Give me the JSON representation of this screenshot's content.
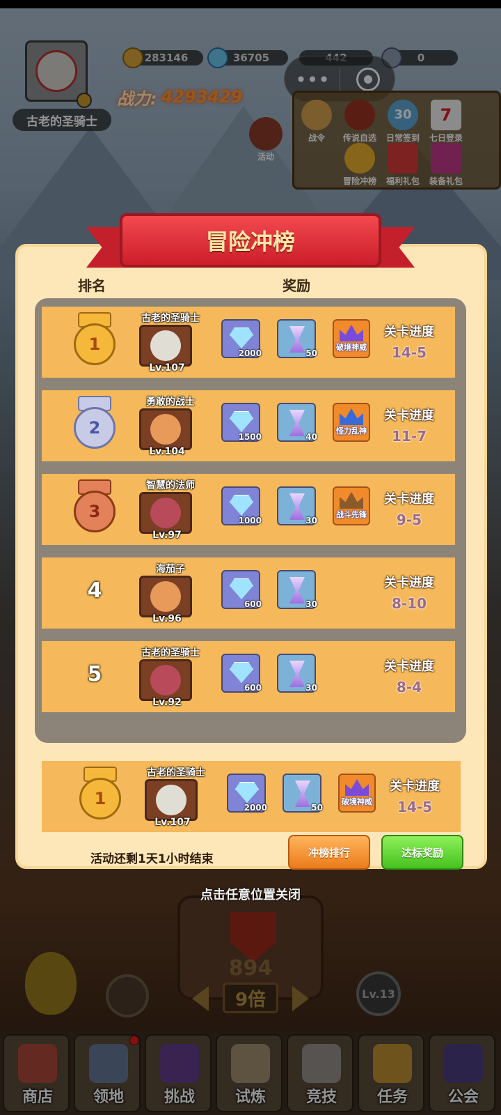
{
  "hud": {
    "player_name": "古老的圣骑士",
    "gold": "283146",
    "diamonds": "36705",
    "resource3": "442",
    "resource4": "0",
    "power_label": "战力:",
    "power_value": "4293429"
  },
  "activities": {
    "left_label": "活动",
    "row1": [
      "战令",
      "传说自选",
      "日常签到",
      "七日登录"
    ],
    "row2": [
      "冒险冲榜",
      "福利礼包",
      "装备礼包"
    ],
    "checkin_badge": "30",
    "seven_day_badge": "7"
  },
  "modal": {
    "title": "冒险冲榜",
    "col_rank": "排名",
    "col_reward": "奖励",
    "progress_label": "关卡进度",
    "rows": [
      {
        "rank": "1",
        "name": "古老的圣骑士",
        "level": "Lv.107",
        "gems": "2000",
        "glass": "50",
        "title": "破境神威",
        "progress": "14-5"
      },
      {
        "rank": "2",
        "name": "勇敢的战士",
        "level": "Lv.104",
        "gems": "1500",
        "glass": "40",
        "title": "怪力乱神",
        "progress": "11-7"
      },
      {
        "rank": "3",
        "name": "智慧的法师",
        "level": "Lv.97",
        "gems": "1000",
        "glass": "30",
        "title": "战斗先锋",
        "progress": "9-5"
      },
      {
        "rank": "4",
        "name": "海茄子",
        "level": "Lv.96",
        "gems": "600",
        "glass": "30",
        "title": "",
        "progress": "8-10"
      },
      {
        "rank": "5",
        "name": "古老的圣骑士",
        "level": "Lv.92",
        "gems": "600",
        "glass": "30",
        "title": "",
        "progress": "8-4"
      }
    ],
    "mine": {
      "rank": "1",
      "name": "古老的圣骑士",
      "level": "Lv.107",
      "gems": "2000",
      "glass": "50",
      "title": "破境神威",
      "progress": "14-5"
    },
    "end_text": "活动还剩1天1小时结束",
    "btn_rank": "冲榜排行",
    "btn_reward": "达标奖励"
  },
  "close_hint": "点击任意位置关闭",
  "game": {
    "chest_count": "894",
    "multiplier": "9倍",
    "level": "Lv.13"
  },
  "nav": [
    "商店",
    "领地",
    "挑战",
    "试炼",
    "竞技",
    "任务",
    "公会"
  ],
  "colors": {
    "gold": "#f5b83a",
    "silver": "#c7cbe6",
    "bronze": "#e3825a",
    "row": "#f5b95b",
    "panel": "#fde7b8",
    "ribbon": "#d8262f"
  }
}
